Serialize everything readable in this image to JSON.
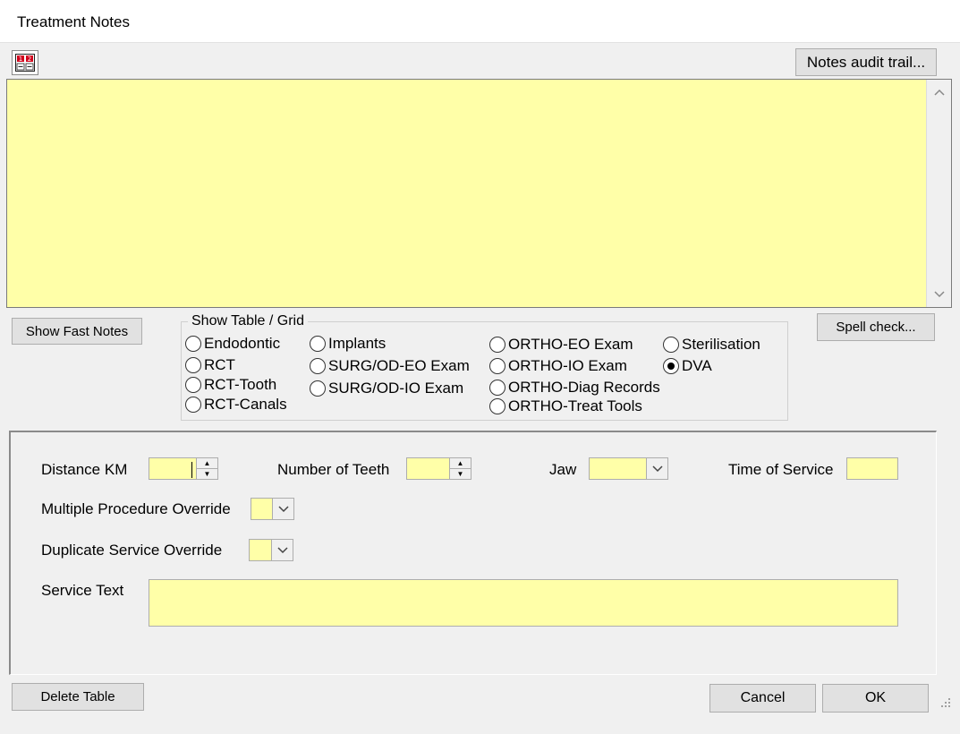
{
  "window": {
    "title": "Treatment Notes"
  },
  "toolbar": {
    "calc_icon": "calculator-icon",
    "audit_trail_label": "Notes audit trail..."
  },
  "notes": {
    "text": ""
  },
  "buttons": {
    "show_fast_notes": "Show Fast Notes",
    "spell_check": "Spell check...",
    "delete_table": "Delete Table",
    "cancel": "Cancel",
    "ok": "OK"
  },
  "table_grid": {
    "legend": "Show Table / Grid",
    "options": [
      {
        "label": "Endodontic",
        "selected": false
      },
      {
        "label": "RCT",
        "selected": false
      },
      {
        "label": "RCT-Tooth",
        "selected": false
      },
      {
        "label": "RCT-Canals",
        "selected": false
      },
      {
        "label": "Implants",
        "selected": false
      },
      {
        "label": "SURG/OD-EO Exam",
        "selected": false
      },
      {
        "label": "SURG/OD-IO Exam",
        "selected": false
      },
      {
        "label": "ORTHO-EO Exam",
        "selected": false
      },
      {
        "label": "ORTHO-IO Exam",
        "selected": false
      },
      {
        "label": "ORTHO-Diag Records",
        "selected": false
      },
      {
        "label": "ORTHO-Treat Tools",
        "selected": false
      },
      {
        "label": "Sterilisation",
        "selected": false
      },
      {
        "label": "DVA",
        "selected": true
      }
    ]
  },
  "dva_form": {
    "distance_km": {
      "label": "Distance KM",
      "value": ""
    },
    "number_of_teeth": {
      "label": "Number of Teeth",
      "value": ""
    },
    "jaw": {
      "label": "Jaw",
      "value": ""
    },
    "time_of_service": {
      "label": "Time of Service",
      "value": ""
    },
    "multiple_procedure_override": {
      "label": "Multiple Procedure Override",
      "value": ""
    },
    "duplicate_service_override": {
      "label": "Duplicate Service Override",
      "value": ""
    },
    "service_text": {
      "label": "Service Text",
      "value": ""
    }
  },
  "colors": {
    "field_yellow": "#ffffa8",
    "dialog_bg": "#f0f0f0",
    "button_face": "#e1e1e1"
  }
}
